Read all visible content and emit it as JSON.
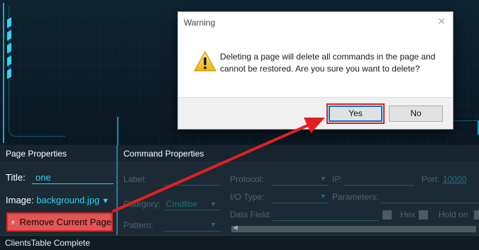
{
  "dialog": {
    "title": "Warning",
    "close_glyph": "✕",
    "icon": "warning-icon",
    "message": "Deleting a page will delete all commands in the page and cannot be restored. Are you sure you want to delete?",
    "yes_label": "Yes",
    "no_label": "No"
  },
  "page_properties": {
    "header": "Page Properties",
    "title_label": "Title:",
    "title_value": "one",
    "image_label": "Image:",
    "image_value": "background.jpg",
    "remove_button_label": "Remove Current Page",
    "remove_icon": "trash-icon"
  },
  "command_properties": {
    "header": "Command Properties",
    "label_label": "Label:",
    "category_label": "Category:",
    "category_value": "Cmdlibe",
    "pattern_label": "Pattern:",
    "protocol_label": "Protocol:",
    "io_type_label": "I/O Type:",
    "data_field_label": "Data Field:",
    "ip_label": "IP:",
    "port_label": "Port:",
    "port_value": "10000",
    "parameters_label": "Parameters:",
    "hex_label": "Hex",
    "hold_on_label": "Hold on"
  },
  "status_bar": {
    "text": "ClientsTable Complete"
  },
  "colors": {
    "accent": "#2fd3f2",
    "annotation_red": "#e02020",
    "remove_button": "#e05555"
  }
}
